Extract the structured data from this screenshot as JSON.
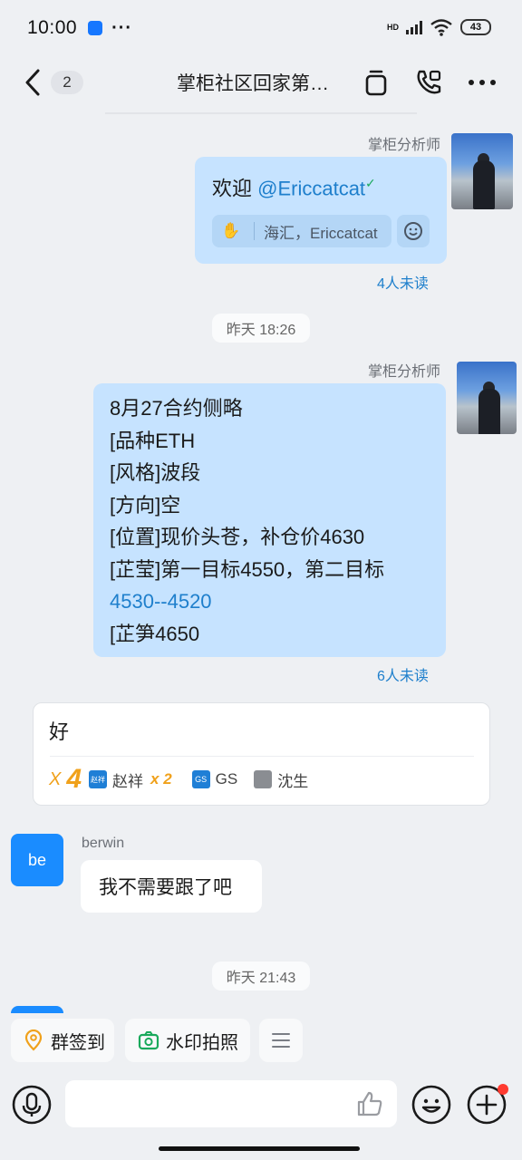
{
  "status_bar": {
    "time": "10:00",
    "dots": "···",
    "network": "HD",
    "battery": "43"
  },
  "header": {
    "unread": "2",
    "title": "掌柜社区回家第…"
  },
  "messages": {
    "m1": {
      "sender": "掌柜分析师",
      "text_prefix": "欢迎 ",
      "mention": "@Ericcatcat",
      "reaction_names": "海汇，Ericcatcat",
      "read": "4人未读"
    },
    "time1": "昨天 18:26",
    "m2": {
      "sender": "掌柜分析师",
      "lines": [
        "8月27合约侧略",
        "[品种ETH",
        "[风格]波段",
        "[方向]空",
        "[位置]现价头苍，补仓价4630",
        "[芷莹]第一目标4550，第二目标"
      ],
      "link_line": "4530--4520",
      "last_line": "[芷笋4650",
      "read": "6人未读"
    },
    "card": {
      "text": "好",
      "multiplier_prefix": "X",
      "multiplier": "4",
      "user1_avatar": "赵祥",
      "user1": "赵祥",
      "user1_count": "x 2",
      "user2_avatar": "GS",
      "user2": "GS",
      "user3": "沈生"
    },
    "m3": {
      "avatar": "be",
      "sender": "berwin",
      "text": "我不需要跟了吧"
    },
    "time2": "昨天 21:43"
  },
  "quick_actions": [
    {
      "label": "群签到"
    },
    {
      "label": "水印拍照"
    }
  ],
  "colors": {
    "bubble_blue": "#c6e3ff",
    "accent": "#1e7fcc",
    "red_dot": "#ff3b30"
  }
}
